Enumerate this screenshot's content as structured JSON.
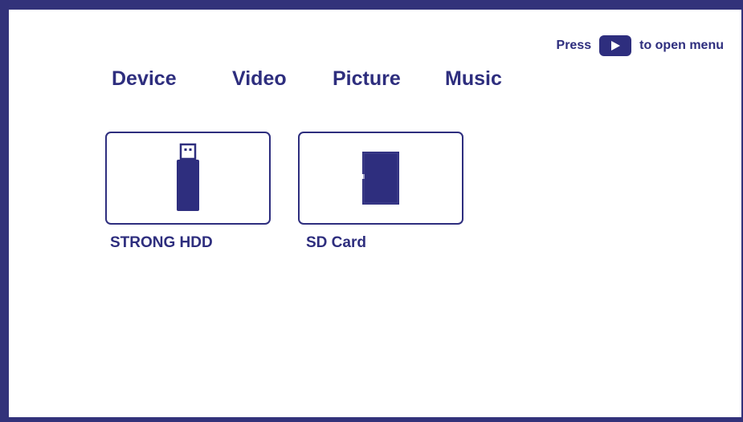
{
  "colors": {
    "accent": "#2e2e7e",
    "frame": "#32327a",
    "background": "#ffffff"
  },
  "hint": {
    "prefix": "Press",
    "icon": "play-icon",
    "suffix": "to open menu"
  },
  "tabs": [
    {
      "label": "Device"
    },
    {
      "label": "Video"
    },
    {
      "label": "Picture"
    },
    {
      "label": "Music"
    }
  ],
  "devices": [
    {
      "label": "STRONG HDD",
      "icon": "usb-drive-icon"
    },
    {
      "label": "SD Card",
      "icon": "sd-card-icon"
    }
  ]
}
